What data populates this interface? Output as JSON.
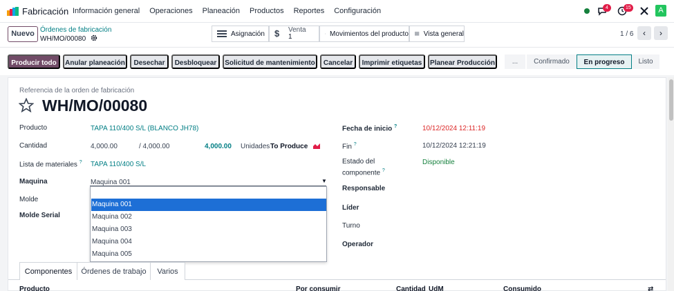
{
  "navbar": {
    "app_name": "Fabricación",
    "menu": [
      "Información general",
      "Operaciones",
      "Planeación",
      "Productos",
      "Reportes",
      "Configuración"
    ],
    "chat_badge": "4",
    "activity_badge": "15",
    "avatar_letter": "A"
  },
  "control": {
    "new_label": "Nuevo",
    "breadcrumb_parent": "Órdenes de fabricación",
    "breadcrumb_current": "WH/MO/00080",
    "smart_buttons": [
      {
        "label": "Asignación",
        "icon": "list-icon"
      },
      {
        "label": "Venta",
        "value": "1",
        "icon": "dollar-icon"
      },
      {
        "label": "Movimientos del producto",
        "icon": "arrows-icon"
      },
      {
        "label": "Vista general",
        "icon": "menu-icon"
      }
    ],
    "pager": "1 / 6"
  },
  "actions": [
    "Producir todo",
    "Anular planeación",
    "Desechar",
    "Desbloquear",
    "Solicitud de mantenimiento",
    "Cancelar",
    "Imprimir etiquetas",
    "Planear Producción"
  ],
  "stages": {
    "more": "...",
    "items": [
      "Confirmado",
      "En progreso",
      "Listo"
    ],
    "current": "En progreso"
  },
  "form": {
    "ref_label": "Referencia de la orden de fabricación",
    "title": "WH/MO/00080",
    "product_label": "Producto",
    "product_value": "TAPA 110/400 S/L (BLANCO JH78)",
    "qty_label": "Cantidad",
    "qty_value": "4,000.00",
    "qty_total": "/ 4,000.00",
    "qty_produce": "4,000.00",
    "qty_uom": "Unidades",
    "qty_to_produce": "To Produce",
    "bom_label": "Lista de materiales",
    "bom_value": "TAPA 110/400 S/L",
    "machine_label": "Maquina",
    "machine_value": "Maquina 001",
    "mold_label": "Molde",
    "mold_serial_label": "Molde Serial",
    "start_label": "Fecha de inicio",
    "start_value": "10/12/2024 12:11:19",
    "end_label": "Fin",
    "end_value": "10/12/2024 12:21:19",
    "component_status_label_1": "Estado del",
    "component_status_label_2": "componente",
    "component_status_value": "Disponible",
    "responsible_label": "Responsable",
    "leader_label": "Líder",
    "shift_label": "Turno",
    "operator_label": "Operador",
    "help_mark": "?"
  },
  "dropdown": {
    "options": [
      "Maquina 001",
      "Maquina 002",
      "Maquina 003",
      "Maquina 004",
      "Maquina 005"
    ],
    "selected": "Maquina 001"
  },
  "tabs": [
    "Componentes",
    "Órdenes de trabajo",
    "Varios"
  ],
  "table_headers": [
    "Producto",
    "Por consumir",
    "Cantidad",
    "UdM",
    "Consumido"
  ]
}
